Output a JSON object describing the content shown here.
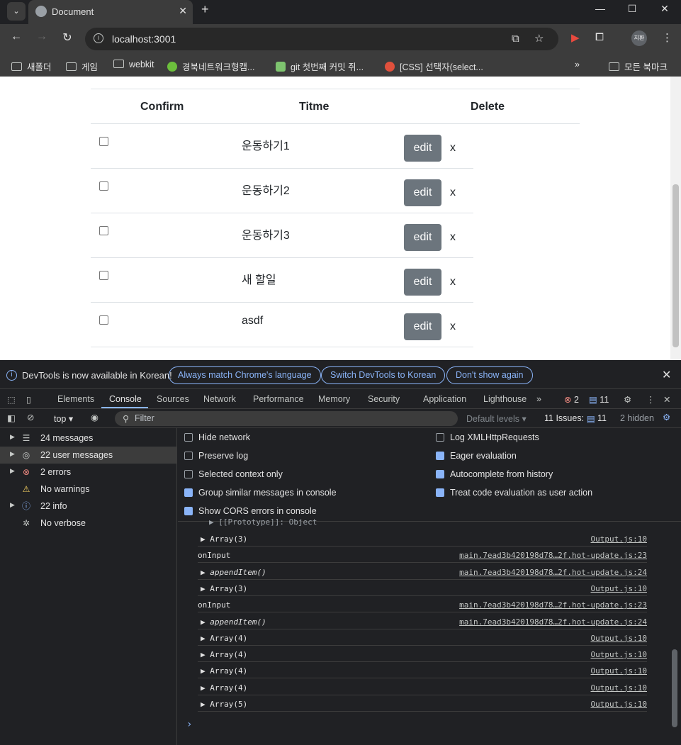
{
  "browser": {
    "tab_title": "Document",
    "url": "localhost:3001",
    "bookmarks": [
      "새폴더",
      "게임",
      "webkit",
      "경북네트워크형캠...",
      "git 첫번째 커밋 쥐...",
      "[CSS] 선택자(select..."
    ],
    "all_bookmarks": "모든 북마크",
    "profile_initials": "지환"
  },
  "todo": {
    "headers": {
      "confirm": "Confirm",
      "title": "Titme",
      "delete": "Delete"
    },
    "edit_label": "edit",
    "delete_label": "x",
    "items": [
      {
        "title": "운동하기1"
      },
      {
        "title": "운동하기2"
      },
      {
        "title": "운동하기3"
      },
      {
        "title": "새 할일"
      },
      {
        "title": "asdf"
      }
    ]
  },
  "devtools": {
    "infobar": {
      "message": "DevTools is now available in Korean!",
      "btn_match": "Always match Chrome's language",
      "btn_switch": "Switch DevTools to Korean",
      "btn_dont": "Don't show again"
    },
    "tabs": [
      "Elements",
      "Console",
      "Sources",
      "Network",
      "Performance",
      "Memory",
      "Security",
      "Application",
      "Lighthouse"
    ],
    "active_tab": "Console",
    "error_count": "2",
    "issue_count": "11",
    "context": "top",
    "filter_placeholder": "Filter",
    "levels": "Default levels",
    "issues_label": "11 Issues:",
    "issues_num": "11",
    "hidden": "2 hidden",
    "sidebar": [
      {
        "label": "24 messages",
        "icon": "list-icon"
      },
      {
        "label": "22 user messages",
        "icon": "user-icon"
      },
      {
        "label": "2 errors",
        "icon": "error-icon"
      },
      {
        "label": "No warnings",
        "icon": "warning-icon"
      },
      {
        "label": "22 info",
        "icon": "info-icon"
      },
      {
        "label": "No verbose",
        "icon": "bug-icon"
      }
    ],
    "settings_left": [
      {
        "label": "Hide network",
        "checked": false
      },
      {
        "label": "Preserve log",
        "checked": false
      },
      {
        "label": "Selected context only",
        "checked": false
      },
      {
        "label": "Group similar messages in console",
        "checked": true
      },
      {
        "label": "Show CORS errors in console",
        "checked": true
      }
    ],
    "settings_right": [
      {
        "label": "Log XMLHttpRequests",
        "checked": false
      },
      {
        "label": "Eager evaluation",
        "checked": true
      },
      {
        "label": "Autocomplete from history",
        "checked": true
      },
      {
        "label": "Treat code evaluation as user action",
        "checked": true
      }
    ],
    "log_partial": "▶ [[Prototype]]: Object",
    "log": [
      {
        "msg": "▶ Array(3)",
        "src": "Output.js:10"
      },
      {
        "msg": "onInput",
        "src": "main.7ead3b420198d78…2f.hot-update.js:23"
      },
      {
        "msg": "▶ appendItem()",
        "src": "main.7ead3b420198d78…2f.hot-update.js:24",
        "italic": true
      },
      {
        "msg": "▶ Array(3)",
        "src": "Output.js:10"
      },
      {
        "msg": "onInput",
        "src": "main.7ead3b420198d78…2f.hot-update.js:23"
      },
      {
        "msg": "▶ appendItem()",
        "src": "main.7ead3b420198d78…2f.hot-update.js:24",
        "italic": true
      },
      {
        "msg": "▶ Array(4)",
        "src": "Output.js:10"
      },
      {
        "msg": "▶ Array(4)",
        "src": "Output.js:10"
      },
      {
        "msg": "▶ Array(4)",
        "src": "Output.js:10"
      },
      {
        "msg": "▶ Array(4)",
        "src": "Output.js:10"
      },
      {
        "msg": "▶ Array(5)",
        "src": "Output.js:10"
      }
    ]
  }
}
